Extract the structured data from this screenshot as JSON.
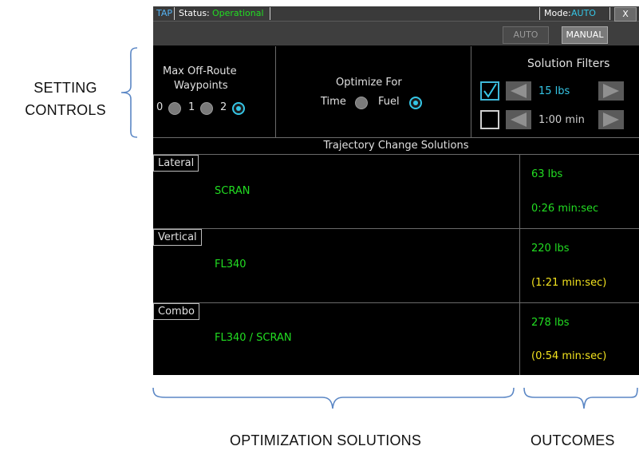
{
  "annotations": {
    "setting_controls": [
      "SETTING",
      "CONTROLS"
    ],
    "optimization_solutions": "OPTIMIZATION SOLUTIONS",
    "outcomes": "OUTCOMES"
  },
  "titlebar": {
    "app": "TAP",
    "status_label": "Status:",
    "status_value": "Operational",
    "mode_label": "Mode:",
    "mode_value": "AUTO",
    "close": "X"
  },
  "modebar": {
    "auto": "AUTO",
    "manual": "MANUAL",
    "active": "MANUAL"
  },
  "settings": {
    "waypoints": {
      "label_line1": "Max Off-Route",
      "label_line2": "Waypoints",
      "options": [
        "0",
        "1",
        "2"
      ],
      "selected": "2"
    },
    "optimize": {
      "label": "Optimize For",
      "options": [
        "Time",
        "Fuel"
      ],
      "selected": "Fuel"
    },
    "filters": {
      "title": "Solution Filters",
      "fuel": {
        "checked": true,
        "value": "15 lbs"
      },
      "time": {
        "checked": false,
        "value": "1:00 min"
      }
    }
  },
  "trajectory": {
    "title": "Trajectory Change Solutions",
    "rows": [
      {
        "type": "Lateral",
        "solution": "SCRAN",
        "fuel": "63 lbs",
        "time": "0:26 min:sec",
        "time_status": "ok"
      },
      {
        "type": "Vertical",
        "solution": "FL340",
        "fuel": "220 lbs",
        "time": "(1:21 min:sec)",
        "time_status": "caution"
      },
      {
        "type": "Combo",
        "solution": "FL340 / SCRAN",
        "fuel": "278 lbs",
        "time": "(0:54 min:sec)",
        "time_status": "caution"
      }
    ]
  },
  "colors": {
    "accent_cyan": "#35c6e6",
    "good_green": "#22dd22",
    "caution_yellow": "#f2e21e",
    "brace_blue": "#5b87c5"
  }
}
